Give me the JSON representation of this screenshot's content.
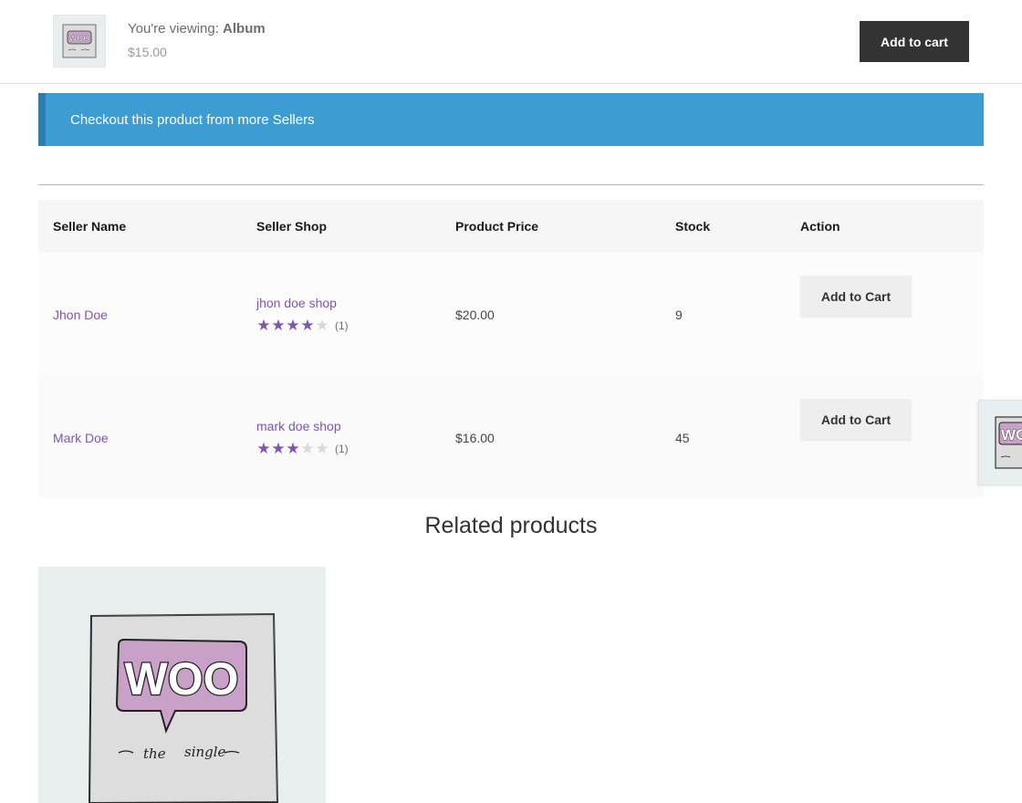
{
  "sticky": {
    "viewing_prefix": "You're viewing: ",
    "product_name": "Album",
    "price": "$15.00",
    "add_to_cart_label": "Add to cart"
  },
  "notice": {
    "text": "Checkout this product from more Sellers"
  },
  "sellers_table": {
    "headers": [
      "Seller Name",
      "Seller Shop",
      "Product Price",
      "Stock",
      "Action"
    ],
    "rows": [
      {
        "seller_name": "Jhon Doe",
        "shop_name": "jhon doe shop",
        "rating": 4,
        "rating_count": "(1)",
        "price": "$20.00",
        "stock": "9",
        "action_label": "Add to Cart"
      },
      {
        "seller_name": "Mark Doe",
        "shop_name": "mark doe shop",
        "rating": 3,
        "rating_count": "(1)",
        "price": "$16.00",
        "stock": "45",
        "action_label": "Add to Cart"
      }
    ]
  },
  "related": {
    "title": "Related products",
    "product_image_text": {
      "logo": "WOO",
      "caption_left": "the",
      "caption_right": "single"
    }
  },
  "colors": {
    "accent_purple": "#7f54b3",
    "notice_blue": "#3d9cd2",
    "dark_button": "#333333"
  }
}
